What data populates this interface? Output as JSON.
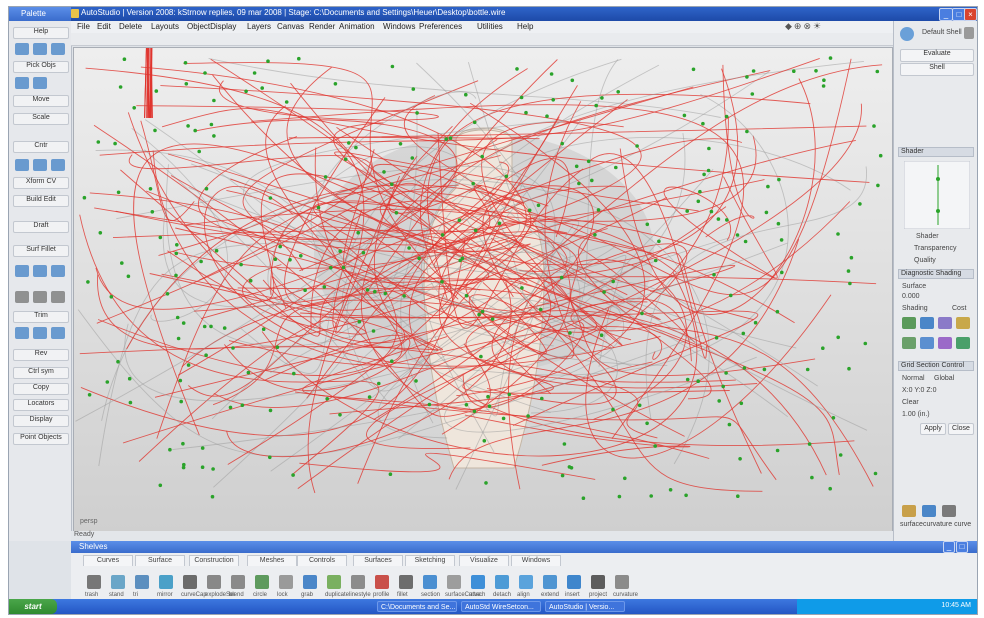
{
  "window": {
    "title": "AutoStudio | Version 2008: kStrnow replies, 09 mar 2008 | Stage: C:\\Documents and Settings\\Heuer\\Desktop\\bottle.wire",
    "controls": [
      "_",
      "□",
      "×"
    ]
  },
  "left_palette": {
    "title": "Palette",
    "buttons": [
      "Help",
      "Pick Objs",
      "Move",
      "Scale",
      "Cntr",
      "Xform CV",
      "Build Edit",
      "Draft",
      "Surf Fillet",
      "Trim",
      "Rev",
      "Ctrl sym",
      "Copy",
      "Locators",
      "Display",
      "Point Objects"
    ]
  },
  "menubar": {
    "items": [
      "File",
      "Edit",
      "Delete",
      "Layouts",
      "ObjectDisplay",
      "Layers",
      "Canvas",
      "Render",
      "Animation",
      "Windows",
      "Preferences",
      "Utilities",
      "Help"
    ],
    "quick_icons": "◆⊕⊗☀"
  },
  "viewport": {
    "label": "persp"
  },
  "right_panel": {
    "top_label": "Default Shell",
    "tabs": [
      "Evaluate",
      "Shell"
    ],
    "sections": [
      "Shader",
      "Diagnostic Shading",
      "Grid Section Control"
    ],
    "shader_text": [
      "Shader",
      "Transparency",
      "Quality"
    ],
    "diag_text": [
      "Surface",
      "0.000",
      "Shading",
      "Cost"
    ],
    "grid_text": [
      "Normal",
      "Global",
      "X:0 Y:0 Z:0",
      "Clear",
      "1.00 (in.)"
    ],
    "apply_label": "Apply",
    "close_label": "Close",
    "bottom_label": "surfacecurvature curve"
  },
  "status_text": "Ready",
  "shelf": {
    "title": "Shelves",
    "tabs": [
      "Curves",
      "Surface",
      "Construction",
      "Meshes",
      "Controls",
      "Surfaces",
      "Sketching",
      "Visualize",
      "Windows"
    ],
    "labels": [
      "trash",
      "stand",
      "tri",
      "mirror",
      "curveCap",
      "explodeSer",
      "blend",
      "circle",
      "lock",
      "grab",
      "duplicate",
      "linestyle",
      "profile",
      "fillet",
      "section",
      "surfaceCurve",
      "attach",
      "detach",
      "align",
      "extend",
      "insert",
      "project",
      "curvature"
    ],
    "icon_colors": [
      "#777777",
      "#6aa6c8",
      "#5c8fbf",
      "#4aa0c8",
      "#6b6b6b",
      "#888888",
      "#8a8a8a",
      "#5e9a5e",
      "#9a9a9a",
      "#4a86c8",
      "#7ab060",
      "#8c8c8c",
      "#c9504a",
      "#6d6d6d",
      "#4b8fd1",
      "#9d9d9d",
      "#3e8fd8",
      "#4d9bd6",
      "#5aa3dc",
      "#4f95d2",
      "#3f86cc",
      "#5d5d5d",
      "#8b8b8b"
    ]
  },
  "taskbar": {
    "start": "start",
    "tasks": [
      "C:\\Documents and Se...",
      "AutoStd WireSetcon...",
      "AutoStudio | Versio..."
    ],
    "clock": "10:45 AM"
  },
  "accents": {
    "trace_red": "#e0342e",
    "point_green": "#2aa32a"
  }
}
